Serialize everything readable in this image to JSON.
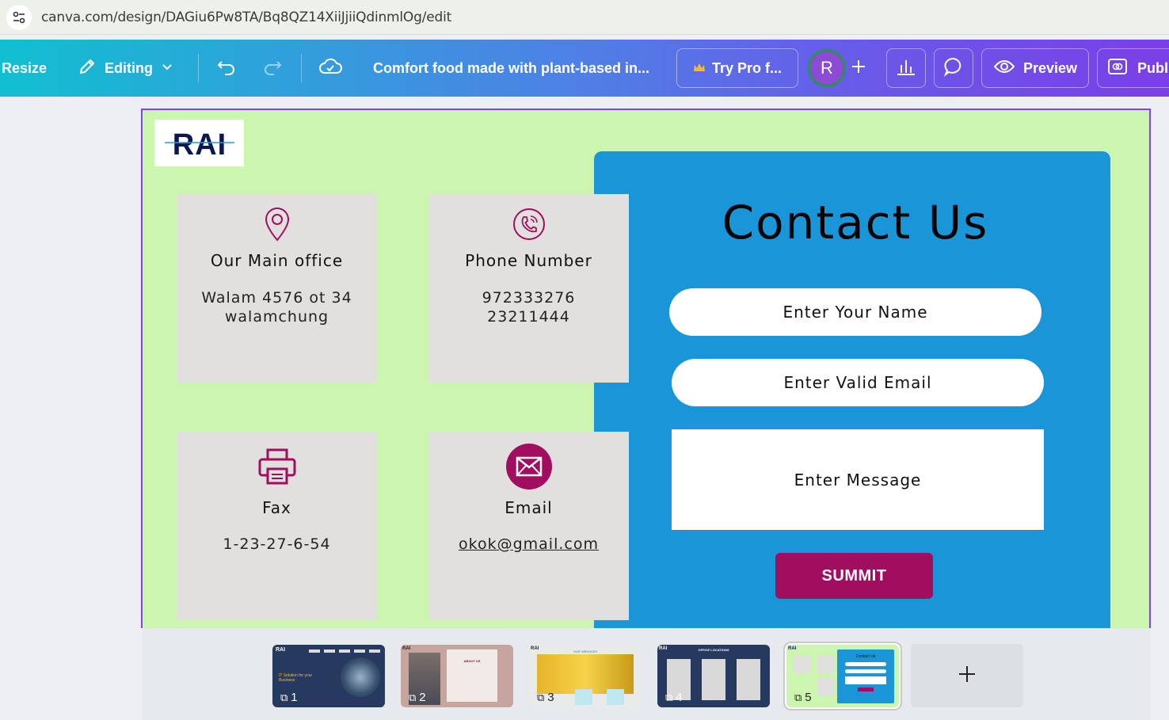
{
  "browser": {
    "url": "canva.com/design/DAGiu6Pw8TA/Bq8QZ14XiiJjiiQdinmlOg/edit"
  },
  "toolbar": {
    "resize_label": "Resize",
    "editing_label": "Editing",
    "design_title": "Comfort food made with plant-based in...",
    "try_pro_label": "Try Pro f...",
    "avatar_initial": "R",
    "preview_label": "Preview",
    "publish_label": "Publi"
  },
  "design": {
    "logo_text": "RAI",
    "cards": [
      {
        "title": "Our Main office",
        "lines": [
          "Walam 4576 ot 34",
          "walamchung"
        ]
      },
      {
        "title": "Phone Number",
        "lines": [
          "972333276",
          "23211444"
        ]
      },
      {
        "title": "Fax",
        "lines": [
          "1-23-27-6-54"
        ]
      },
      {
        "title": "Email",
        "lines": [
          "okok@gmail.com"
        ]
      }
    ],
    "contact_title": "Contact Us",
    "name_field": "Enter Your Name",
    "email_field": "Enter Valid Email",
    "message_field": "Enter Message",
    "submit_label": "SUMMIT"
  },
  "pages": [
    {
      "number": "1",
      "thumb_text": "IT Solution for your Business"
    },
    {
      "number": "2",
      "thumb_text": "ABOUT US"
    },
    {
      "number": "3",
      "thumb_text": "OUR SERVICES"
    },
    {
      "number": "4",
      "thumb_text": "OFFICE LOCATIONS"
    },
    {
      "number": "5",
      "thumb_text": "Contact Us"
    }
  ],
  "colors": {
    "page_bg": "#ccf5b0",
    "panel_blue": "#1a96d8",
    "card_gray": "#e2e0df",
    "accent_magenta": "#a10d5f",
    "selection_purple": "#8b3dff"
  }
}
